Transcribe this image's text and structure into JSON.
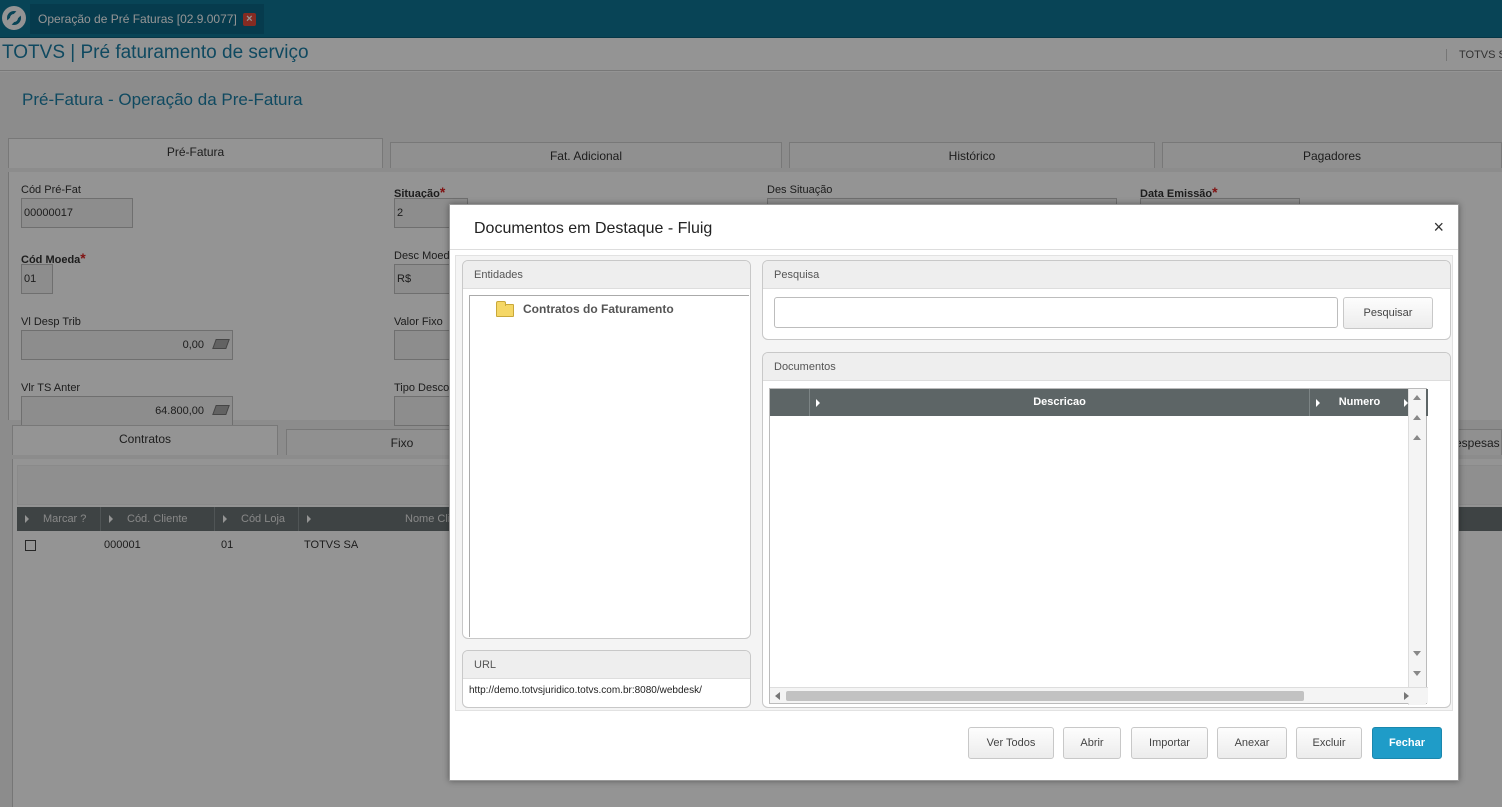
{
  "app_tab": {
    "title": "Operação de Pré Faturas [02.9.0077]",
    "close": "×"
  },
  "header": {
    "title": "TOTVS | Pré faturamento de serviço",
    "company": "TOTVS S"
  },
  "page": {
    "title": "Pré-Fatura - Operação da Pre-Fatura",
    "tabs": [
      "Pré-Fatura",
      "Fat. Adicional",
      "Histórico",
      "Pagadores"
    ],
    "fields": {
      "cod_pre_fat": {
        "label": "Cód Pré-Fat",
        "value": "00000017"
      },
      "situacao": {
        "label": "Situação",
        "value": "2"
      },
      "des_situacao": {
        "label": "Des Situação"
      },
      "data_emissao": {
        "label": "Data Emissão"
      },
      "cod_moeda": {
        "label": "Cód Moeda",
        "value": "01"
      },
      "desc_moeda": {
        "label": "Desc Moed",
        "value": "R$"
      },
      "vl_desp_trib": {
        "label": "Vl Desp Trib",
        "value": "0,00"
      },
      "valor_fixo": {
        "label": "Valor Fixo"
      },
      "vlr_ts_anter": {
        "label": "Vlr TS Anter",
        "value": "64.800,00"
      },
      "tipo_desco": {
        "label": "Tipo Desco"
      },
      "required_mark": "*"
    },
    "subtabs": [
      "Contratos",
      "Fixo",
      "Despesas"
    ],
    "grid": {
      "columns": [
        "Marcar ?",
        "Cód. Cliente",
        "Cód Loja",
        "Nome Cli"
      ],
      "rows": [
        {
          "cliente": "000001",
          "loja": "01",
          "nome": "TOTVS SA"
        }
      ]
    }
  },
  "modal": {
    "title": "Documentos em Destaque - Fluig",
    "close": "×",
    "entidades": {
      "header": "Entidades",
      "tree_item": "Contratos do Faturamento"
    },
    "url": {
      "header": "URL",
      "value": "http://demo.totvsjuridico.totvs.com.br:8080/webdesk/"
    },
    "pesquisa": {
      "header": "Pesquisa",
      "input_value": "",
      "button": "Pesquisar"
    },
    "documentos": {
      "header": "Documentos",
      "columns": [
        "Descricao",
        "Numero"
      ]
    },
    "buttons": {
      "ver_todos": "Ver Todos",
      "abrir": "Abrir",
      "importar": "Importar",
      "anexar": "Anexar",
      "excluir": "Excluir",
      "fechar": "Fechar"
    }
  },
  "colors": {
    "brand": "#0f7595",
    "title_blue": "#1b7fa6",
    "primary_button": "#1f9cc8",
    "required": "#dd2222"
  }
}
